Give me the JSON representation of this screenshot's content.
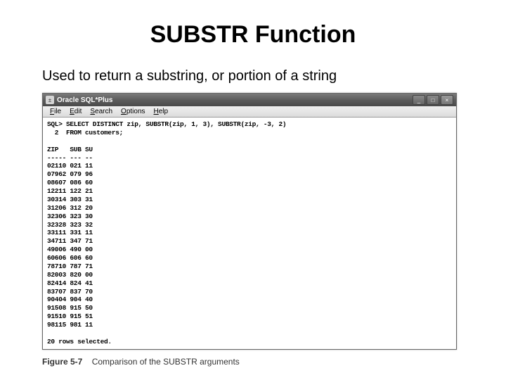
{
  "title": "SUBSTR Function",
  "subtitle": "Used to return a substring, or portion of a string",
  "window": {
    "app_title": "Oracle SQL*Plus",
    "menu": [
      "File",
      "Edit",
      "Search",
      "Options",
      "Help"
    ]
  },
  "sql": {
    "prompt": "SQL>",
    "line1": "SELECT DISTINCT zip, SUBSTR(zip, 1, 3), SUBSTR(zip, -3, 2)",
    "line2_num": "2",
    "line2": "FROM customers;"
  },
  "columns": {
    "c1": "ZIP",
    "c2": "SUB",
    "c3": "SU"
  },
  "divider": {
    "c1": "-----",
    "c2": "---",
    "c3": "--"
  },
  "rows": [
    {
      "zip": "02110",
      "sub": "021",
      "su": "11"
    },
    {
      "zip": "07962",
      "sub": "079",
      "su": "96"
    },
    {
      "zip": "08607",
      "sub": "086",
      "su": "60"
    },
    {
      "zip": "12211",
      "sub": "122",
      "su": "21"
    },
    {
      "zip": "30314",
      "sub": "303",
      "su": "31"
    },
    {
      "zip": "31206",
      "sub": "312",
      "su": "20"
    },
    {
      "zip": "32306",
      "sub": "323",
      "su": "30"
    },
    {
      "zip": "32328",
      "sub": "323",
      "su": "32"
    },
    {
      "zip": "33111",
      "sub": "331",
      "su": "11"
    },
    {
      "zip": "34711",
      "sub": "347",
      "su": "71"
    },
    {
      "zip": "49006",
      "sub": "490",
      "su": "00"
    },
    {
      "zip": "60606",
      "sub": "606",
      "su": "60"
    },
    {
      "zip": "78710",
      "sub": "787",
      "su": "71"
    },
    {
      "zip": "82003",
      "sub": "820",
      "su": "00"
    },
    {
      "zip": "82414",
      "sub": "824",
      "su": "41"
    },
    {
      "zip": "83707",
      "sub": "837",
      "su": "70"
    },
    {
      "zip": "90404",
      "sub": "904",
      "su": "40"
    },
    {
      "zip": "91508",
      "sub": "915",
      "su": "50"
    },
    {
      "zip": "91510",
      "sub": "915",
      "su": "51"
    },
    {
      "zip": "98115",
      "sub": "981",
      "su": "11"
    }
  ],
  "footer": "20 rows selected.",
  "caption": {
    "label": "Figure 5-7",
    "text": "Comparison of the SUBSTR arguments"
  }
}
